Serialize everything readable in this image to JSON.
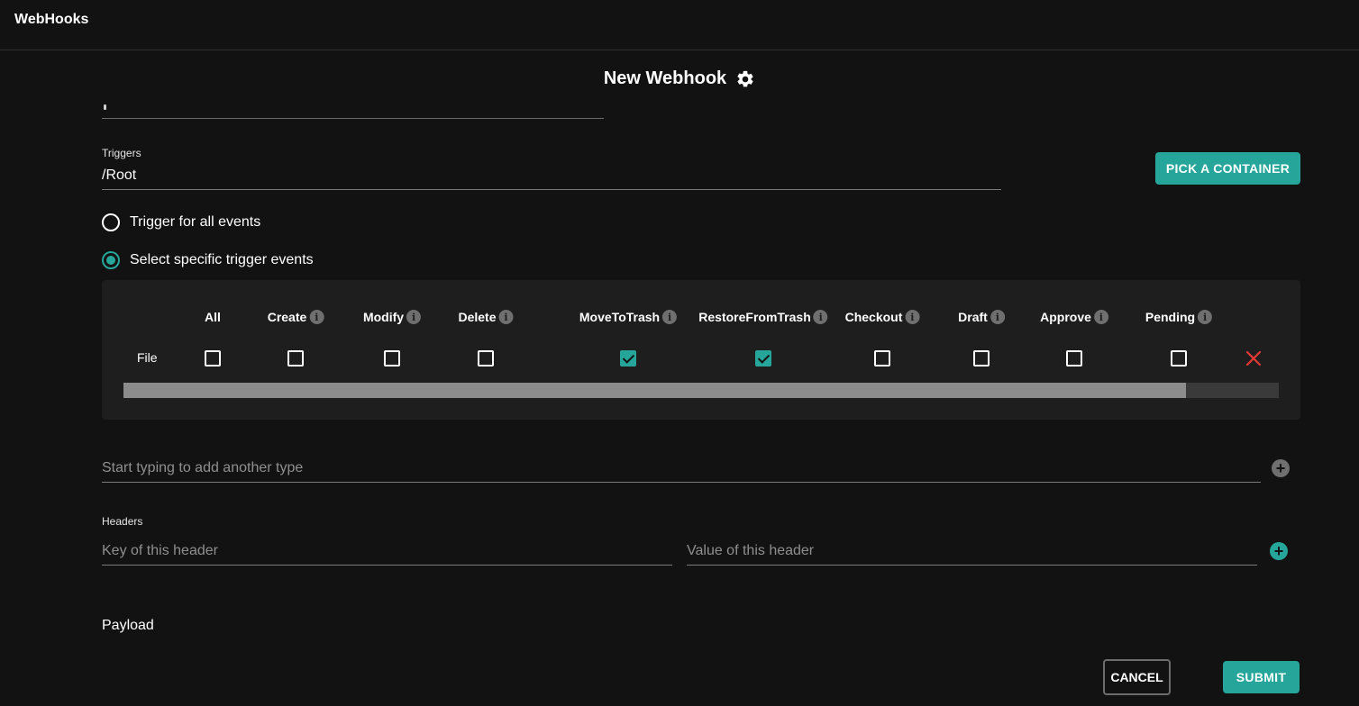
{
  "app": {
    "title": "WebHooks"
  },
  "dialog": {
    "title": "New Webhook",
    "settings_icon": "gear-icon"
  },
  "triggers": {
    "label": "Triggers",
    "value": "/Root",
    "pick_button": "PICK A CONTAINER"
  },
  "radios": {
    "all_events": {
      "label": "Trigger for all events",
      "checked": false
    },
    "specific_events": {
      "label": "Select specific trigger events",
      "checked": true
    }
  },
  "events_table": {
    "columns": [
      {
        "label": "All",
        "info": false
      },
      {
        "label": "Create",
        "info": true
      },
      {
        "label": "Modify",
        "info": true
      },
      {
        "label": "Delete",
        "info": true
      },
      {
        "label": "MoveToTrash",
        "info": true
      },
      {
        "label": "RestoreFromTrash",
        "info": true
      },
      {
        "label": "Checkout",
        "info": true
      },
      {
        "label": "Draft",
        "info": true
      },
      {
        "label": "Approve",
        "info": true
      },
      {
        "label": "Pending",
        "info": true
      }
    ],
    "rows": [
      {
        "label": "File",
        "checked": [
          false,
          false,
          false,
          false,
          true,
          true,
          false,
          false,
          false,
          false
        ]
      }
    ],
    "scroll_position": 0.92
  },
  "type_input": {
    "placeholder": "Start typing to add another type"
  },
  "headers": {
    "label": "Headers",
    "key_placeholder": "Key of this header",
    "value_placeholder": "Value of this header"
  },
  "payload": {
    "label": "Payload"
  },
  "actions": {
    "cancel": "CANCEL",
    "submit": "SUBMIT"
  },
  "colors": {
    "accent": "#26a69a",
    "danger": "#e53935",
    "background": "#121212",
    "panel": "#1e1e1e"
  }
}
